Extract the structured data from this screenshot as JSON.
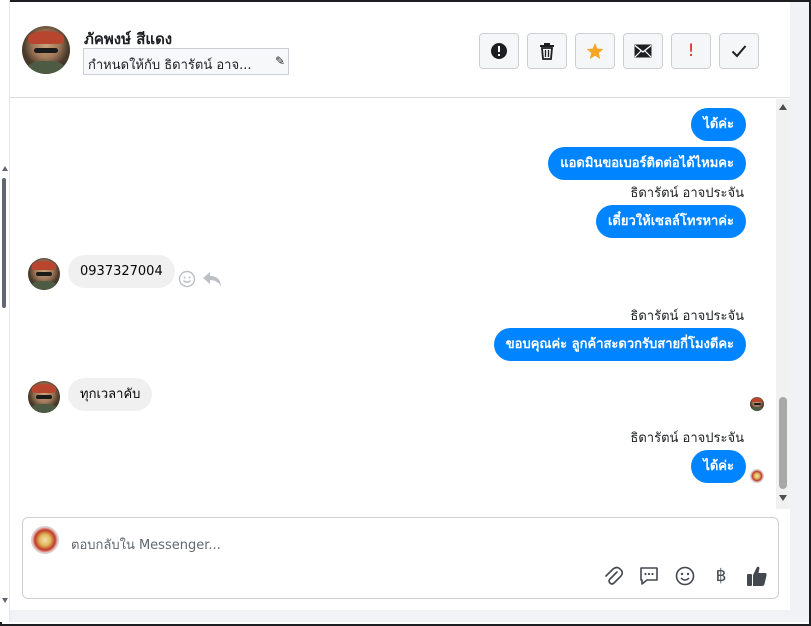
{
  "header": {
    "contact_name": "ภัคพงษ์ สีแดง",
    "assign_text": "กำหนดให้กับ ธิดารัตน์ อาจ...",
    "pencil_glyph": "✎",
    "toolbar": [
      {
        "name": "spam-button",
        "icon": "alert-circle-icon"
      },
      {
        "name": "delete-button",
        "icon": "trash-icon"
      },
      {
        "name": "star-button",
        "icon": "star-icon"
      },
      {
        "name": "mark-unread-button",
        "icon": "envelope-icon"
      },
      {
        "name": "mark-important-button",
        "icon": "exclamation-icon"
      },
      {
        "name": "mark-done-button",
        "icon": "checkmark-icon"
      }
    ],
    "important_mark": "!"
  },
  "messages": [
    {
      "type": "out",
      "text": "ได้ค่ะ"
    },
    {
      "type": "out",
      "text": "แอดมินขอเบอร์ติดต่อได้ไหมคะ"
    },
    {
      "type": "sender",
      "text": "ธิดารัตน์ อาจประจัน"
    },
    {
      "type": "out",
      "text": "เดี๋ยวให้เซลล์โทรหาค่ะ"
    },
    {
      "type": "in",
      "text": "0937327004"
    },
    {
      "type": "sender",
      "text": "ธิดารัตน์ อาจประจัน"
    },
    {
      "type": "out",
      "text": "ขอบคุณค่ะ ลูกค้าสะดวกรับสายกี่โมงดีคะ"
    },
    {
      "type": "in",
      "text": "ทุกเวลาคับ"
    },
    {
      "type": "sender",
      "text": "ธิดารัตน์ อาจประจัน"
    },
    {
      "type": "out",
      "text": "ได้ค่ะ"
    }
  ],
  "composer": {
    "placeholder": "ตอบกลับใน Messenger...",
    "baht_glyph": "฿"
  },
  "colors": {
    "outgoing_bubble": "#0084ff",
    "incoming_bubble": "#f0f0f0",
    "star": "#f5a623",
    "important": "#e02020"
  }
}
